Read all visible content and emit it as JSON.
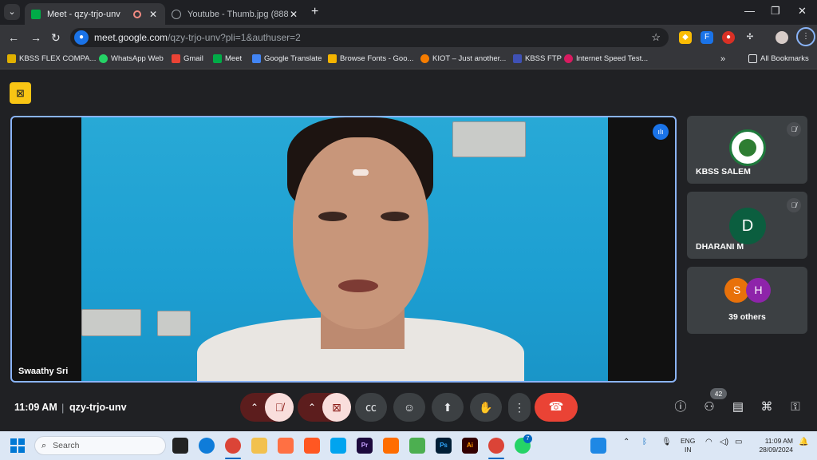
{
  "browser": {
    "tabs": [
      {
        "title": "Meet - qzy-trjo-unv",
        "active": true
      },
      {
        "title": "Youtube - Thumb.jpg (8889×5(",
        "active": false
      }
    ],
    "url_host": "meet.google.com",
    "url_path": "/qzy-trjo-unv?pli=1&authuser=2",
    "bookmarks": [
      "KBSS FLEX COMPA...",
      "WhatsApp Web",
      "Gmail",
      "Meet",
      "Google Translate",
      "Browse Fonts - Goo...",
      "KIOT – Just another...",
      "KBSS FTP",
      "Internet Speed Test...",
      "All Bookmarks"
    ]
  },
  "meet": {
    "main_speaker": "Swaathy Sri",
    "side_tiles": [
      {
        "name": "KBSS SALEM",
        "muted": true
      },
      {
        "name": "DHARANI M",
        "initial": "D",
        "muted": true
      }
    ],
    "others": {
      "initials": [
        "S",
        "H"
      ],
      "label": "39 others"
    },
    "time": "11:09 AM",
    "divider": "|",
    "meeting_code": "qzy-trjo-unv",
    "participant_count": "42",
    "colors": {
      "accent": "#8ab4f8",
      "hangup": "#ea4335",
      "muted_bg": "#f9dedc"
    }
  },
  "taskbar": {
    "search_placeholder": "Search",
    "lang_line1": "ENG",
    "lang_line2": "IN",
    "clock_time": "11:09 AM",
    "clock_date": "28/09/2024",
    "whatsapp_badge": "7"
  }
}
